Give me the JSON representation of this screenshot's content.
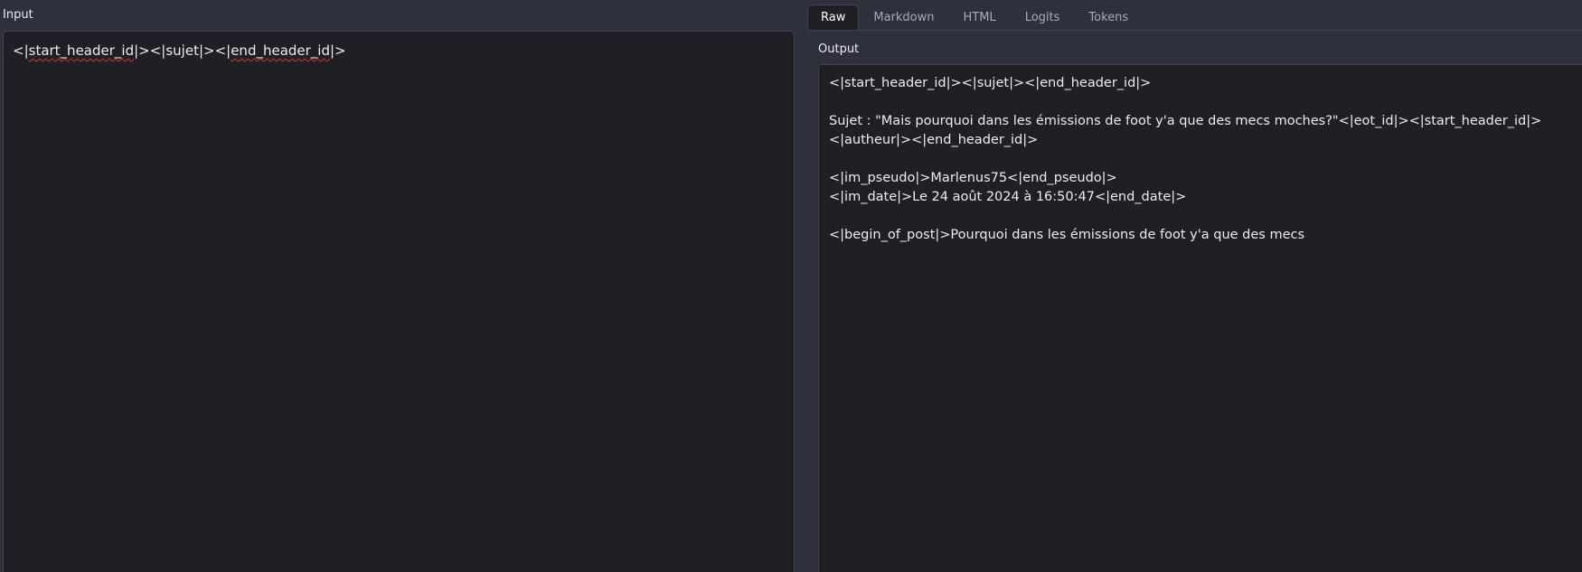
{
  "input": {
    "label": "Input",
    "value_parts": [
      "<|",
      "start_header_id",
      "|><|sujet|><|",
      "end_header_id",
      "|>"
    ]
  },
  "tabs": [
    {
      "label": "Raw",
      "active": true
    },
    {
      "label": "Markdown",
      "active": false
    },
    {
      "label": "HTML",
      "active": false
    },
    {
      "label": "Logits",
      "active": false
    },
    {
      "label": "Tokens",
      "active": false
    }
  ],
  "output": {
    "label": "Output",
    "lines": [
      "<|start_header_id|><|sujet|><|end_header_id|>",
      "",
      "Sujet : \"Mais pourquoi dans les émissions de foot y'a que des mecs moches?\"<|eot_id|><|start_header_id|>",
      "<|autheur|><|end_header_id|>",
      "",
      "<|im_pseudo|>Marlenus75<|end_pseudo|>",
      "<|im_date|>Le 24 août 2024 à 16:50:47<|end_date|>",
      "",
      "<|begin_of_post|>Pourquoi dans les émissions de foot y'a que des mecs"
    ]
  },
  "colors": {
    "background": "#2f303d",
    "panel": "#1f2024",
    "border": "#41434e",
    "spellcheck": "#e0301e"
  }
}
